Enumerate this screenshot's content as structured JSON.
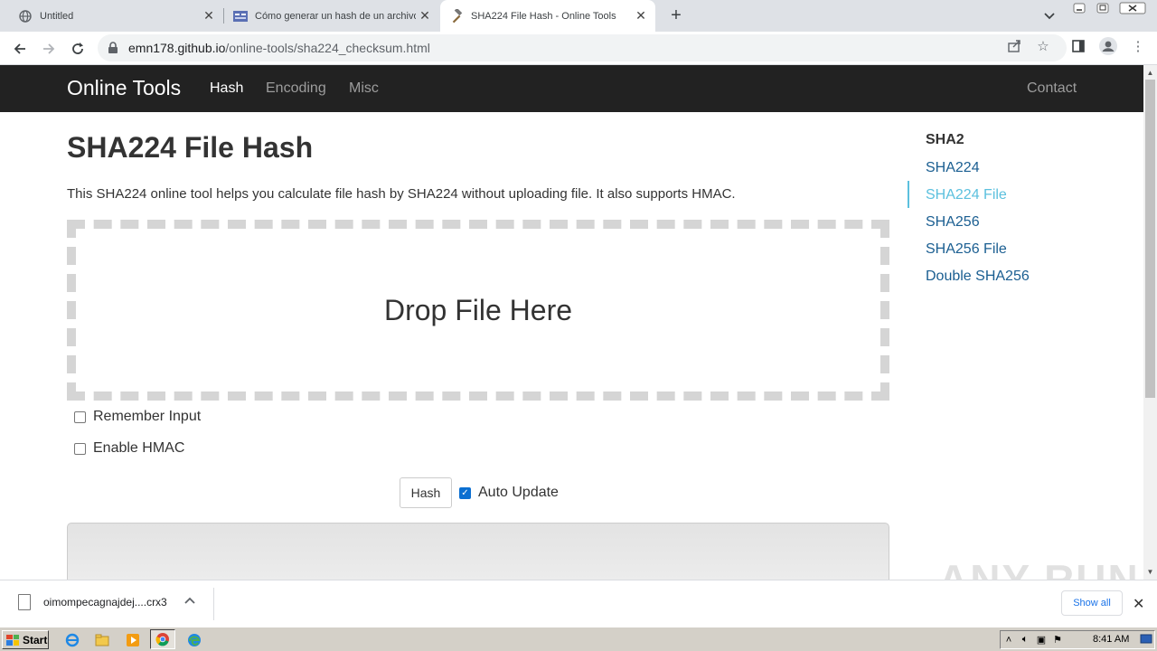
{
  "browser": {
    "tabs": [
      {
        "title": "Untitled",
        "icon": "globe-icon"
      },
      {
        "title": "Cómo generar un hash de un archivo",
        "icon": "site-favicon"
      },
      {
        "title": "SHA224 File Hash - Online Tools",
        "icon": "hammer-icon"
      }
    ],
    "url_host": "emn178.github.io",
    "url_path": "/online-tools/sha224_checksum.html"
  },
  "site": {
    "brand": "Online Tools",
    "nav": [
      "Hash",
      "Encoding",
      "Misc"
    ],
    "contact": "Contact"
  },
  "page": {
    "title": "SHA224 File Hash",
    "description": "This SHA224 online tool helps you calculate file hash by SHA224 without uploading file. It also supports HMAC.",
    "dropzone": "Drop File Here",
    "remember_input": "Remember Input",
    "enable_hmac": "Enable HMAC",
    "hash_button": "Hash",
    "auto_update": "Auto Update"
  },
  "sidebar": {
    "heading": "SHA2",
    "items": [
      "SHA224",
      "SHA224 File",
      "SHA256",
      "SHA256 File",
      "Double SHA256"
    ]
  },
  "downloads": {
    "filename": "oimompecagnajdej....crx3",
    "show_all": "Show all"
  },
  "taskbar": {
    "start": "Start",
    "time": "8:41 AM"
  },
  "watermark": "ANY RUN",
  "colors": {
    "navbar": "#222222",
    "link": "#1a5e91",
    "active_link": "#5bc0de"
  }
}
